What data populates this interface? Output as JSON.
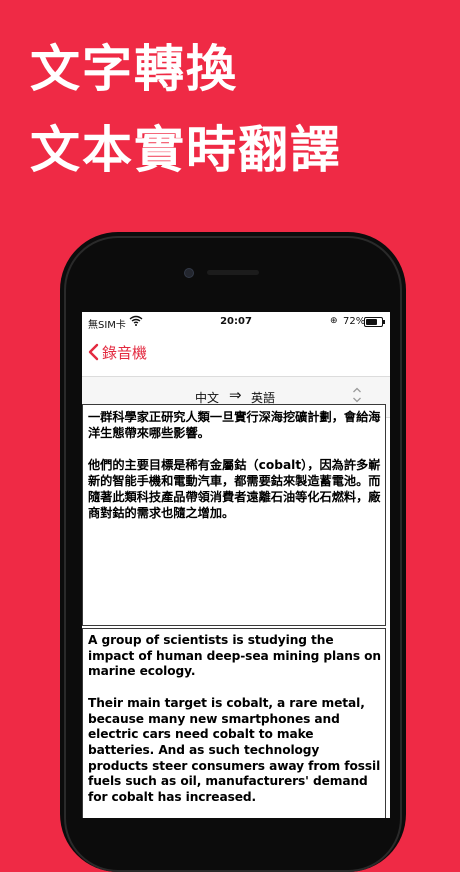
{
  "promo": {
    "line1": "文字轉換",
    "line2": "文本實時翻譯"
  },
  "status_bar": {
    "carrier": "無SIM卡",
    "time": "20:07",
    "battery": "72%",
    "battery_level": 0.72
  },
  "nav": {
    "back_label": "錄音機"
  },
  "language_bar": {
    "source": "中文",
    "arrow": "⇒",
    "target": "英語"
  },
  "source_text": {
    "paragraphs": [
      "一群科學家正研究人類一旦實行深海挖礦計劃，會給海洋生態帶來哪些影響。",
      "他們的主要目標是稀有金屬鈷（cobalt），因為許多嶄新的智能手機和電動汽車，都需要鈷來製造蓄電池。而隨著此類科技產品帶領消費者遠離石油等化石燃料，廠商對鈷的需求也隨之增加。"
    ]
  },
  "translated_text": {
    "paragraphs": [
      "A group of scientists is studying the impact of human deep-sea mining plans on marine ecology.",
      "Their main target is cobalt, a rare metal, because many new smartphones and electric cars need cobalt to make batteries. And as such technology products steer consumers away from fossil fuels such as oil, manufacturers' demand for cobalt has increased."
    ]
  },
  "colors": {
    "background": "#ef2a45",
    "accent": "#e3293f"
  },
  "icons": {
    "back": "chevron-left-icon",
    "swap": "double-arrow-right-icon",
    "sort": "up-down-chevron-icon",
    "wifi": "wifi-icon",
    "lock": "orientation-lock-icon",
    "battery": "battery-icon"
  }
}
